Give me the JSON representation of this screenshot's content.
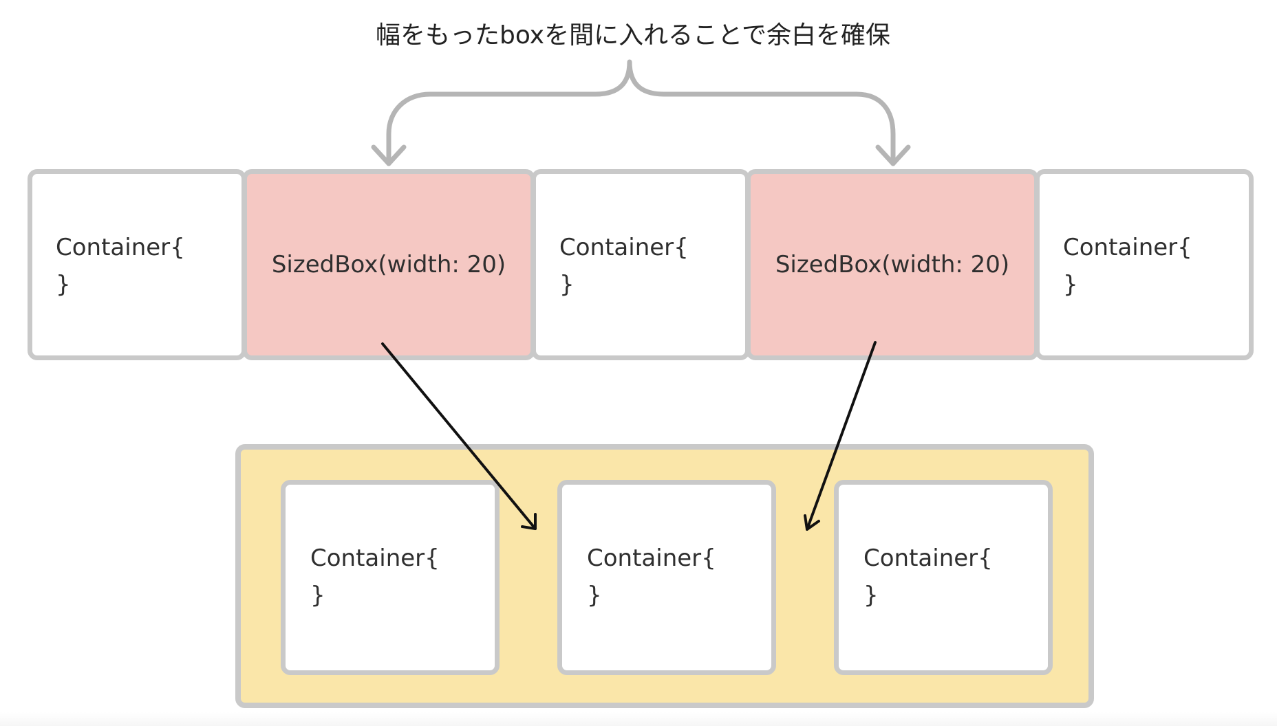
{
  "caption": "幅をもったboxを間に入れることで余白を確保",
  "top_row": [
    {
      "kind": "container",
      "line1": "Container{",
      "line2": "}"
    },
    {
      "kind": "sizedbox",
      "label": "SizedBox(width: 20)"
    },
    {
      "kind": "container",
      "line1": "Container{",
      "line2": "}"
    },
    {
      "kind": "sizedbox",
      "label": "SizedBox(width: 20)"
    },
    {
      "kind": "container",
      "line1": "Container{",
      "line2": "}"
    }
  ],
  "bottom_row": [
    {
      "line1": "Container{",
      "line2": "}"
    },
    {
      "line1": "Container{",
      "line2": "}"
    },
    {
      "line1": "Container{",
      "line2": "}"
    }
  ],
  "colors": {
    "border": "#c9c9c9",
    "sizedbox_fill": "#f5c8c3",
    "row_fill": "#fae6a9",
    "brace": "#b5b5b5",
    "arrow": "#111111"
  }
}
